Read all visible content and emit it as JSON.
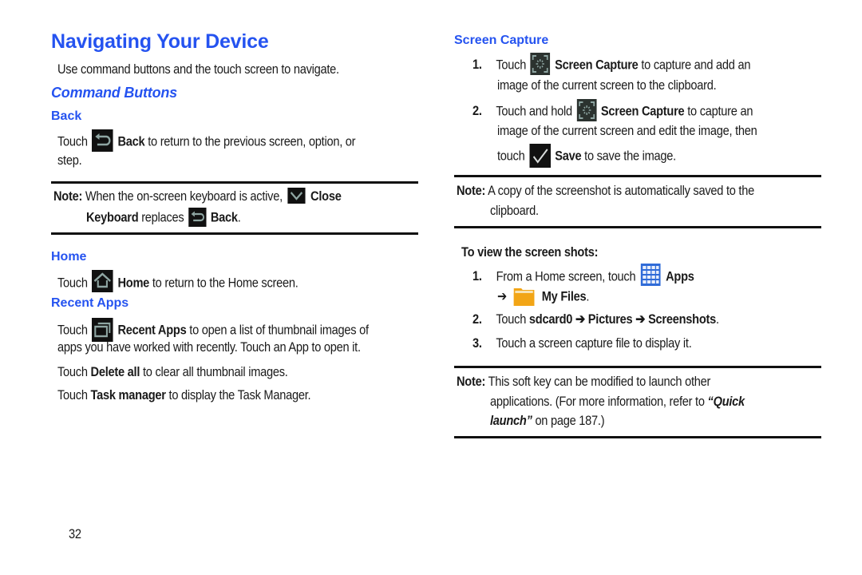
{
  "page": {
    "title": "Navigating Your Device",
    "intro": "Use command buttons and the touch screen to navigate.",
    "page_number": "32",
    "accent_color": "#2553f0"
  },
  "left": {
    "command_buttons_heading": "Command Buttons",
    "back": {
      "heading": "Back",
      "line1_pre": "Touch",
      "line1_bold": "Back",
      "line1_post": "to return to the previous screen, option, or",
      "line2": "step.",
      "icon": "back-arrow-icon"
    },
    "note1": {
      "label": "Note:",
      "line1_pre": "When the on-screen keyboard is active,",
      "line1_bold": "Close",
      "line2_bold": "Keyboard",
      "line2_mid": "replaces",
      "line2_bold2": "Back",
      "line2_end": ".",
      "icons": [
        "close-keyboard-chevron-icon",
        "back-arrow-icon"
      ]
    },
    "home": {
      "heading": "Home",
      "pre": "Touch",
      "bold": "Home",
      "post": "to return to the Home screen.",
      "icon": "home-icon"
    },
    "recent_apps": {
      "heading": "Recent Apps",
      "line1_pre": "Touch",
      "line1_bold": "Recent Apps",
      "line1_post": "to open a list of thumbnail images of",
      "line2": "apps you have worked with recently. Touch an App to open it.",
      "delete_pre": "Touch",
      "delete_bold": "Delete all",
      "delete_post": "to clear all thumbnail images.",
      "task_pre": "Touch",
      "task_bold": "Task manager",
      "task_post": "to display the Task Manager.",
      "icon": "recent-apps-icon"
    }
  },
  "right": {
    "screen_capture": {
      "heading": "Screen Capture",
      "steps": [
        {
          "num": "1.",
          "pre": "Touch",
          "bold": "Screen Capture",
          "post": "to capture and add an",
          "line2": "image of the current screen to the clipboard."
        },
        {
          "num": "2.",
          "pre": "Touch and hold",
          "bold": "Screen Capture",
          "post": "to capture an",
          "line2": "image of the current screen and edit the image, then",
          "line3_pre": "touch",
          "line3_bold": "Save",
          "line3_post": "to save the image."
        }
      ]
    },
    "note2": {
      "label": "Note:",
      "line1": "A copy of the screenshot is automatically saved to the",
      "line2": "clipboard."
    },
    "view": {
      "heading": "To view the screen shots:",
      "steps": [
        {
          "num": "1.",
          "pre": "From a Home screen, touch",
          "bold": "Apps",
          "arrow": "➔",
          "bold2": "My Files",
          "end": "."
        },
        {
          "num": "2.",
          "pre": "Touch",
          "path": [
            "sdcard0",
            "Pictures",
            "Screenshots"
          ],
          "arrow": "➔",
          "end": "."
        },
        {
          "num": "3.",
          "text": "Touch a screen capture file to display it."
        }
      ]
    },
    "note3": {
      "label": "Note:",
      "line1": "This soft key can be modified to launch other",
      "line2_pre": "applications. (For more information, refer to",
      "line2_link": "“Quick",
      "line3_link": "launch”",
      "line3_post": "on page 187.)"
    }
  }
}
